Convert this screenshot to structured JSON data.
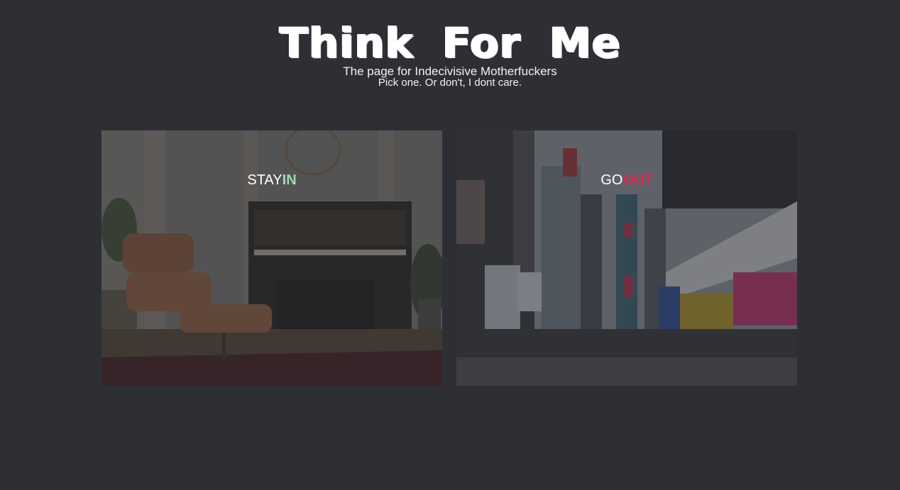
{
  "header": {
    "title": "Think For Me",
    "tagline": "The page for Indecivisive Motherfuckers",
    "subtagline": "Pick one. Or don't, I dont care."
  },
  "options": [
    {
      "prefix": "STAY",
      "accent": "IN",
      "accent_color": "#9fd8b6",
      "image": "living-room-piano-image"
    },
    {
      "prefix": "GO",
      "accent": "OUT",
      "accent_color": "#e2264e",
      "image": "city-times-square-image"
    }
  ],
  "colors": {
    "background": "#2d2f35",
    "text": "#ffffff"
  }
}
